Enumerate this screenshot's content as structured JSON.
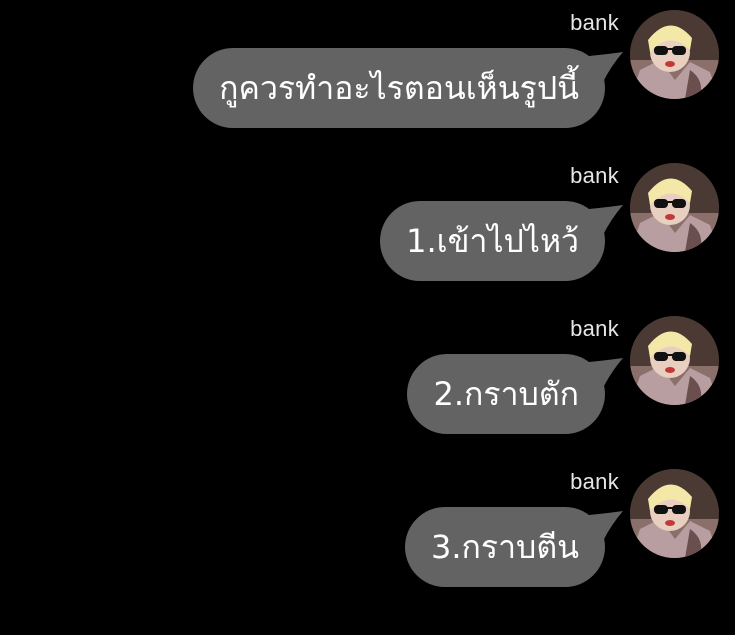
{
  "chat": {
    "messages": [
      {
        "sender": "bank",
        "text": "กูควรทำอะไรตอนเห็นรูปนี้",
        "avatar_icon": "user-avatar-icon"
      },
      {
        "sender": "bank",
        "text": "1.เข้าไปไหว้",
        "avatar_icon": "user-avatar-icon"
      },
      {
        "sender": "bank",
        "text": "2.กราบตัก",
        "avatar_icon": "user-avatar-icon"
      },
      {
        "sender": "bank",
        "text": "3.กราบตีน",
        "avatar_icon": "user-avatar-icon"
      }
    ]
  },
  "colors": {
    "background": "#000000",
    "bubble": "#636363",
    "bubble_text": "#ffffff",
    "sender_text": "#e6e6e6"
  }
}
